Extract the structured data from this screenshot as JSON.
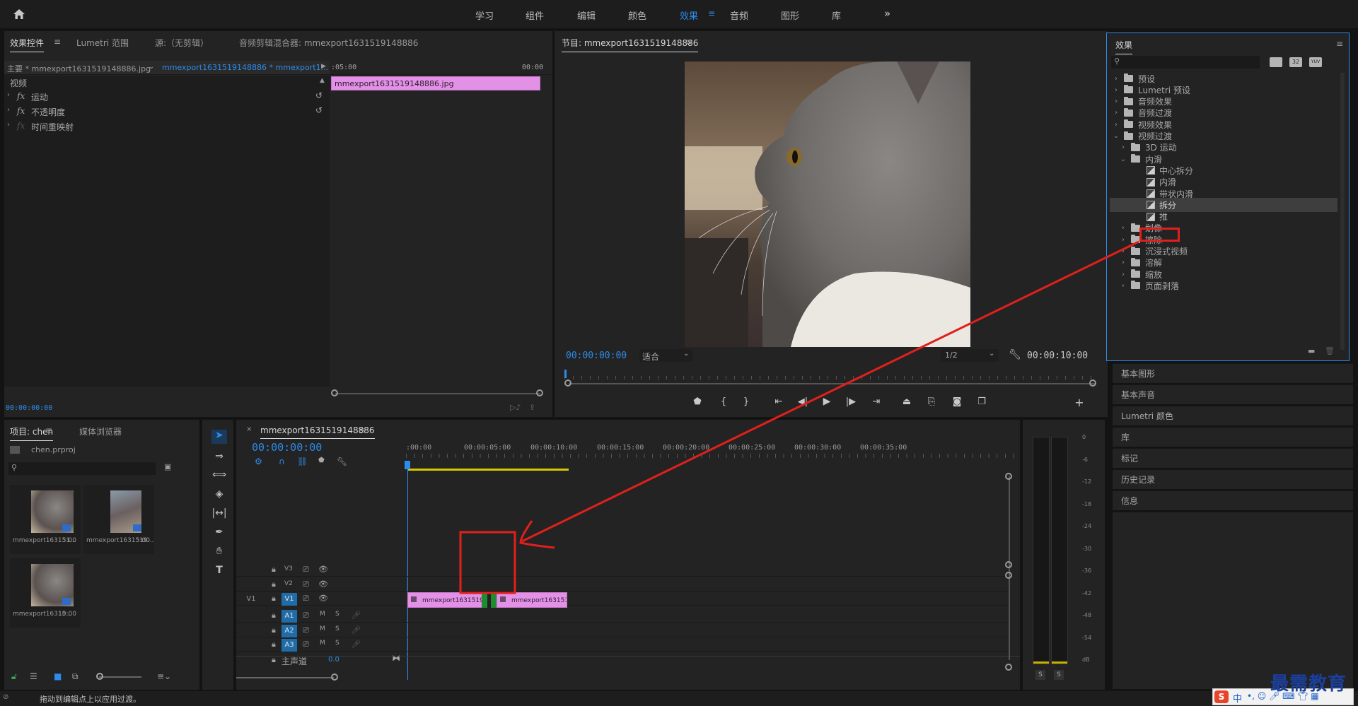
{
  "topbar": {
    "home_icon": "home-icon",
    "workspaces": [
      "学习",
      "组件",
      "编辑",
      "颜色",
      "效果",
      "音频",
      "图形",
      "库"
    ],
    "active_workspace": "效果",
    "more": "»"
  },
  "effect_controls": {
    "tabs": [
      "效果控件",
      "Lumetri 范围",
      "源:（无剪辑）",
      "音频剪辑混合器: mmexport1631519148886"
    ],
    "master_label": "主要 * mmexport1631519148886.jpg",
    "sequence_label": "mmexport1631519148886 * mmexport1...",
    "ruler_start": ":05:00",
    "ruler_end": "00:00",
    "clip_name": "mmexport1631519148886.jpg",
    "section_video": "视频",
    "properties": [
      "运动",
      "不透明度",
      "时间重映射"
    ],
    "timecode": "00:00:00:00"
  },
  "program": {
    "title": "节目: mmexport1631519148886",
    "timecode_left": "00:00:00:00",
    "fit": "适合",
    "resolution": "1/2",
    "timecode_right": "00:00:10:00"
  },
  "effects_panel": {
    "title": "效果",
    "search_placeholder": "",
    "badges": [
      "32",
      "YUV"
    ],
    "tree": [
      {
        "label": "预设",
        "level": 0,
        "type": "folder-star",
        "open": false
      },
      {
        "label": "Lumetri 预设",
        "level": 0,
        "type": "folder-star",
        "open": false
      },
      {
        "label": "音频效果",
        "level": 0,
        "type": "folder",
        "open": false
      },
      {
        "label": "音频过渡",
        "level": 0,
        "type": "folder",
        "open": false
      },
      {
        "label": "视频效果",
        "level": 0,
        "type": "folder",
        "open": false
      },
      {
        "label": "视频过渡",
        "level": 0,
        "type": "folder",
        "open": true
      },
      {
        "label": "3D 运动",
        "level": 1,
        "type": "folder",
        "open": false
      },
      {
        "label": "内滑",
        "level": 1,
        "type": "folder",
        "open": true
      },
      {
        "label": "中心拆分",
        "level": 2,
        "type": "fx"
      },
      {
        "label": "内滑",
        "level": 2,
        "type": "fx"
      },
      {
        "label": "带状内滑",
        "level": 2,
        "type": "fx"
      },
      {
        "label": "拆分",
        "level": 2,
        "type": "fx",
        "selected": true
      },
      {
        "label": "推",
        "level": 2,
        "type": "fx"
      },
      {
        "label": "划像",
        "level": 1,
        "type": "folder",
        "open": false
      },
      {
        "label": "擦除",
        "level": 1,
        "type": "folder",
        "open": false
      },
      {
        "label": "沉浸式视频",
        "level": 1,
        "type": "folder",
        "open": false
      },
      {
        "label": "溶解",
        "level": 1,
        "type": "folder",
        "open": false
      },
      {
        "label": "缩放",
        "level": 1,
        "type": "folder",
        "open": false
      },
      {
        "label": "页面剥落",
        "level": 1,
        "type": "folder",
        "open": false
      }
    ]
  },
  "side_panels": [
    "基本图形",
    "基本声音",
    "Lumetri 颜色",
    "库",
    "标记",
    "历史记录",
    "信息"
  ],
  "project": {
    "tabs": [
      "项目: chen",
      "媒体浏览器"
    ],
    "file": "chen.prproj",
    "items": [
      {
        "name": "mmexport163151...",
        "duration": "5:00"
      },
      {
        "name": "mmexport1631519...",
        "duration": "5:00"
      },
      {
        "name": "mmexport16315...",
        "duration": "10:00"
      }
    ]
  },
  "timeline": {
    "title": "mmexport1631519148886",
    "timecode": "00:00:00:00",
    "ruler": [
      ":00:00",
      "00:00:05:00",
      "00:00:10:00",
      "00:00:15:00",
      "00:00:20:00",
      "00:00:25:00",
      "00:00:30:00",
      "00:00:35:00"
    ],
    "video_tracks": [
      "V3",
      "V2",
      "V1"
    ],
    "source_patch": "V1",
    "audio_tracks": [
      "A1",
      "A2",
      "A3"
    ],
    "master": "主声道",
    "master_value": "0.0",
    "mute": "M",
    "solo": "S",
    "clip1": "mmexport1631519",
    "clip2": "mmexport1631519"
  },
  "meter": {
    "ticks": [
      "0",
      "-6",
      "-12",
      "-18",
      "-24",
      "-30",
      "-36",
      "-42",
      "-48",
      "-54",
      "dB"
    ],
    "solo_labels": [
      "S",
      "S"
    ]
  },
  "status": {
    "message": "拖动到编辑点上以应用过渡。"
  },
  "watermark": "最需教育",
  "ime": "中"
}
